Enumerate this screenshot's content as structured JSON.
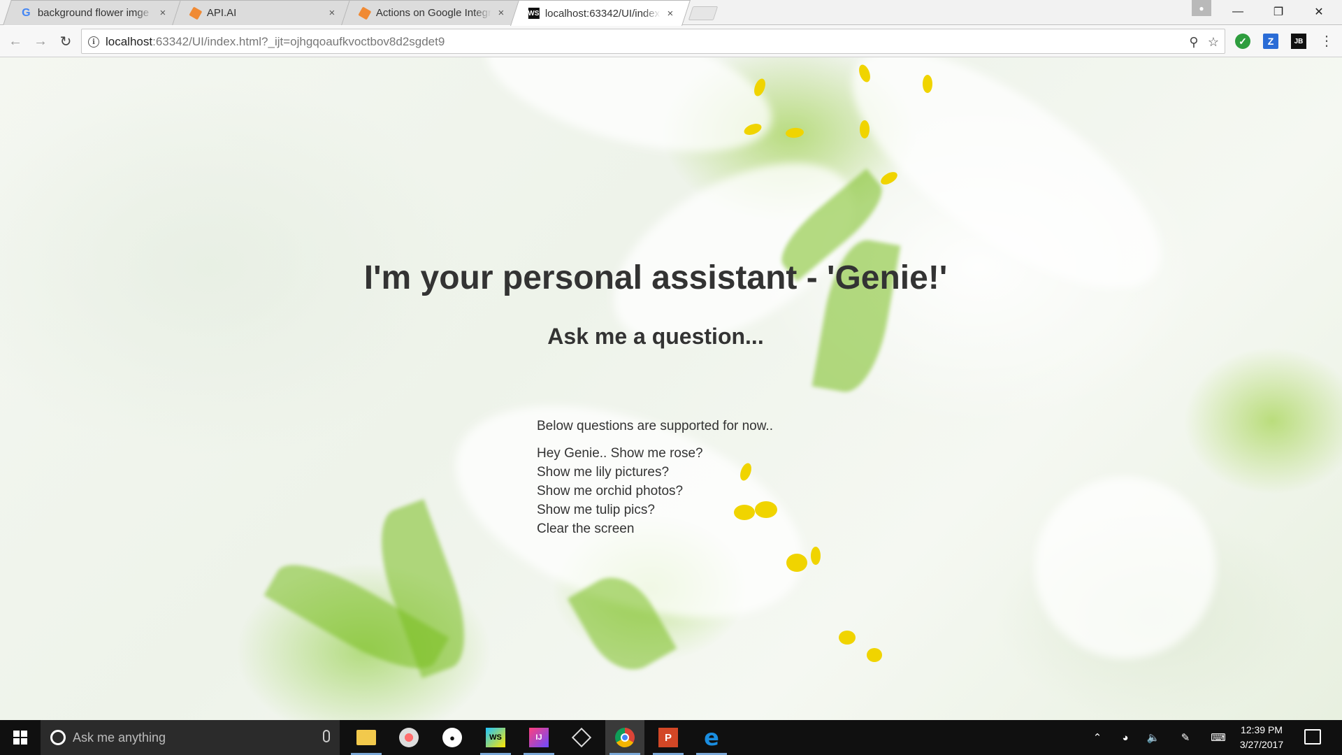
{
  "browser": {
    "tabs": [
      {
        "title": "background flower imge",
        "favicon": "google-g-icon",
        "active": false
      },
      {
        "title": "API.AI",
        "favicon": "api-ai-cube-icon",
        "active": false
      },
      {
        "title": "Actions on Google Integr",
        "favicon": "api-ai-cube-icon",
        "active": false
      },
      {
        "title": "localhost:63342/UI/index",
        "favicon": "webstorm-icon",
        "active": true
      }
    ],
    "close_glyph": "×",
    "url_host": "localhost",
    "url_rest": ":63342/UI/index.html?_ijt=ojhgqoaufkvoctbov8d2sgdet9",
    "ext_z_label": "Z",
    "ext_jb_label": "JB"
  },
  "page": {
    "headline": "I'm your personal assistant - 'Genie!'",
    "subheadline": "Ask me a question...",
    "supported_intro": "Below questions are supported for now..",
    "questions": [
      "Hey Genie.. Show me rose?",
      "Show me lily pictures?",
      "Show me orchid photos?",
      "Show me tulip pics?",
      "Clear the screen"
    ]
  },
  "taskbar": {
    "search_placeholder": "Ask me anything",
    "ws_label": "WS",
    "ij_label": "IJ",
    "ppt_label": "P",
    "edge_label": "e",
    "time": "12:39 PM",
    "date": "3/27/2017"
  },
  "colors": {
    "accent_green": "#2e9d3e",
    "text": "#333333",
    "taskbar": "#101010"
  }
}
